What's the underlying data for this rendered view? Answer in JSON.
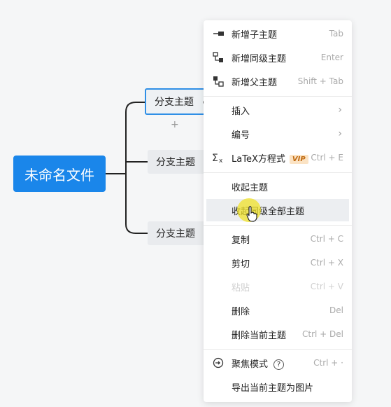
{
  "mindmap": {
    "root_label": "未命名文件",
    "branches": [
      "分支主题",
      "分支主题",
      "分支主题"
    ],
    "add_symbol": "+"
  },
  "menu": {
    "items": [
      {
        "label": "新增子主题",
        "shortcut": "Tab",
        "icon": "add-child-icon"
      },
      {
        "label": "新增同级主题",
        "shortcut": "Enter",
        "icon": "add-sibling-icon"
      },
      {
        "label": "新增父主题",
        "shortcut": "Shift + Tab",
        "icon": "add-parent-icon"
      },
      {
        "label": "插入",
        "arrow": "›"
      },
      {
        "label": "编号",
        "arrow": "›"
      },
      {
        "label": "LaTeX方程式",
        "badge": "VIP",
        "shortcut": "Ctrl + E",
        "icon": "sigma-icon"
      },
      {
        "label": "收起主题"
      },
      {
        "label": "收起同级全部主题"
      },
      {
        "label": "复制",
        "shortcut": "Ctrl + C"
      },
      {
        "label": "剪切",
        "shortcut": "Ctrl + X"
      },
      {
        "label": "粘贴",
        "shortcut": "Ctrl + V",
        "disabled": true
      },
      {
        "label": "删除",
        "shortcut": "Del"
      },
      {
        "label": "删除当前主题",
        "shortcut": "Ctrl + Del"
      },
      {
        "label": "聚焦模式",
        "shortcut": "Ctrl + ·",
        "help": "?",
        "icon": "focus-icon"
      },
      {
        "label": "导出当前主题为图片"
      }
    ]
  },
  "colors": {
    "root_bg": "#1a86ea",
    "selected_border": "#2f8fe6",
    "vip_bg": "#fbe3c4"
  }
}
